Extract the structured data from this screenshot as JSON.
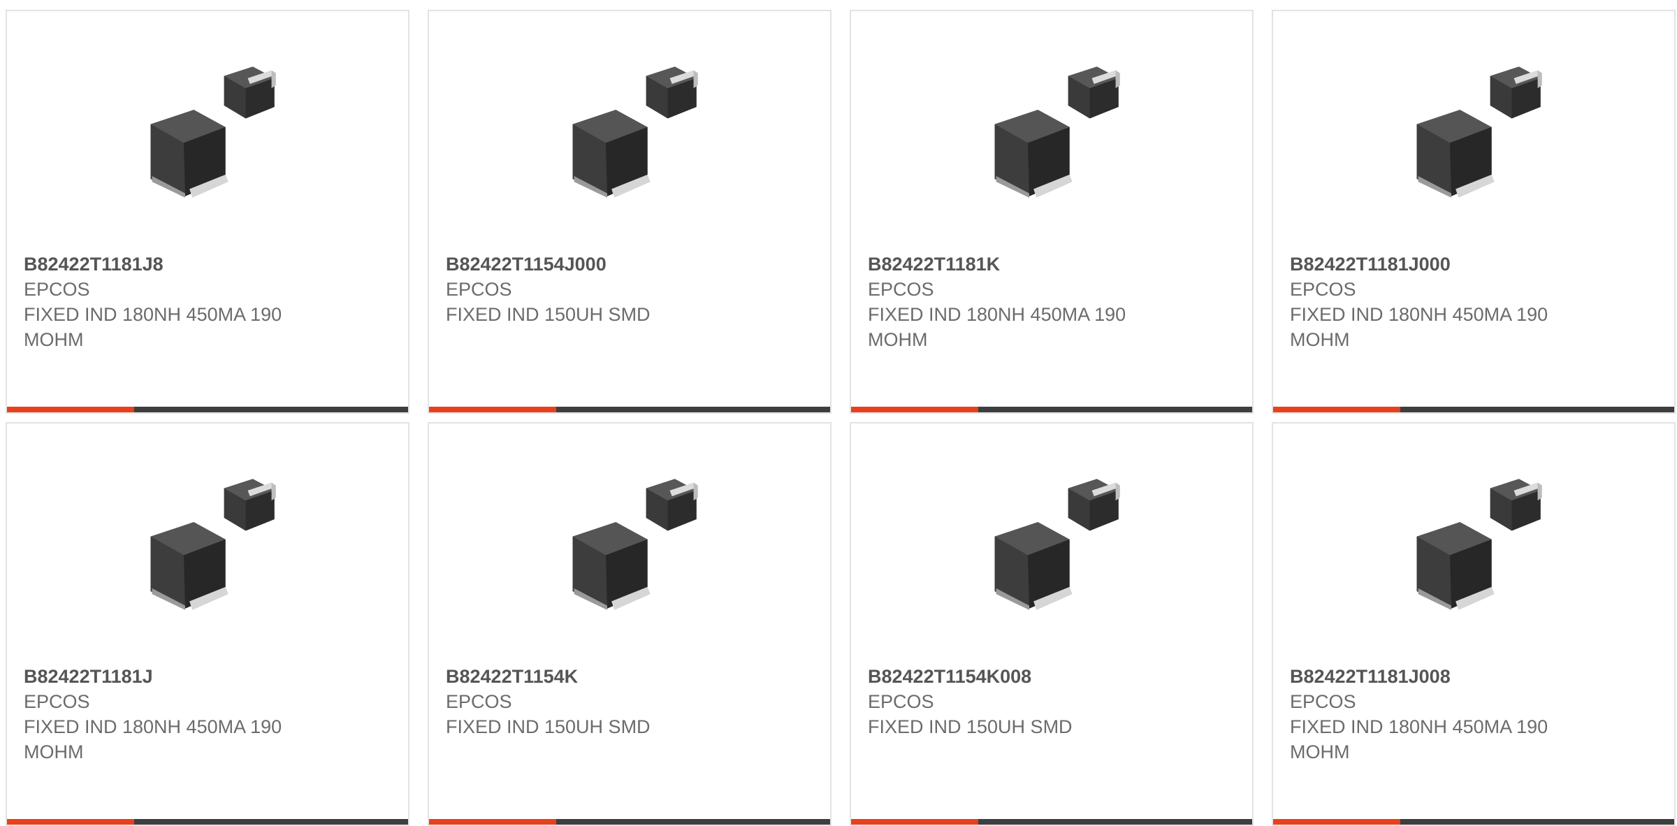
{
  "colors": {
    "accent": "#e8401c",
    "bar": "#3e3e3e",
    "border": "#e3e3e3",
    "text": "#6b6b6b"
  },
  "image_icon": "smd-inductor-icon",
  "products": [
    {
      "part_number": "B82422T1181J8",
      "manufacturer": "EPCOS",
      "description": "FIXED IND 180NH 450MA 190 MOHM"
    },
    {
      "part_number": "B82422T1154J000",
      "manufacturer": "EPCOS",
      "description": "FIXED IND 150UH SMD"
    },
    {
      "part_number": "B82422T1181K",
      "manufacturer": "EPCOS",
      "description": "FIXED IND 180NH 450MA 190 MOHM"
    },
    {
      "part_number": "B82422T1181J000",
      "manufacturer": "EPCOS",
      "description": "FIXED IND 180NH 450MA 190 MOHM"
    },
    {
      "part_number": "B82422T1181J",
      "manufacturer": "EPCOS",
      "description": "FIXED IND 180NH 450MA 190 MOHM"
    },
    {
      "part_number": "B82422T1154K",
      "manufacturer": "EPCOS",
      "description": "FIXED IND 150UH SMD"
    },
    {
      "part_number": "B82422T1154K008",
      "manufacturer": "EPCOS",
      "description": "FIXED IND 150UH SMD"
    },
    {
      "part_number": "B82422T1181J008",
      "manufacturer": "EPCOS",
      "description": "FIXED IND 180NH 450MA 190 MOHM"
    }
  ]
}
